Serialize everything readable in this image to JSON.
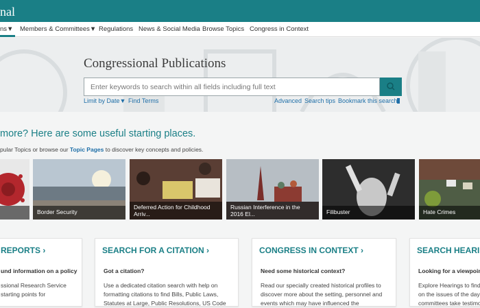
{
  "header": {
    "brand": "nal"
  },
  "nav": {
    "items": [
      {
        "label": "ns▼"
      },
      {
        "label": "Members & Committees▼"
      },
      {
        "label": "Regulations"
      },
      {
        "label": "News & Social Media"
      },
      {
        "label": "Browse Topics"
      },
      {
        "label": "Congress in Context"
      }
    ]
  },
  "hero": {
    "title": "Congressional Publications",
    "search_placeholder": "Enter keywords to search within all fields including full text",
    "limit_by_date": "Limit by Date▼",
    "find_terms": "Find Terms",
    "advanced": "Advanced",
    "search_tips": "Search tips",
    "bookmark": "Bookmark this search"
  },
  "starting": {
    "heading": "more? Here are some useful starting places.",
    "intro_pre": "pular Topics or browse our ",
    "intro_link": "Topic Pages",
    "intro_post": " to discover key concepts and policies."
  },
  "tiles": [
    {
      "label": ""
    },
    {
      "label": "Border Security"
    },
    {
      "label": "Deferred Action for Childhood Arriv..."
    },
    {
      "label": "Russian Interference in the 2016 El..."
    },
    {
      "label": "Filibuster"
    },
    {
      "label": "Hate Crimes"
    }
  ],
  "cards": [
    {
      "title": "REPORTS ›",
      "subtitle": "und information on a policy",
      "body": "ssional Research Service\nstarting points for"
    },
    {
      "title": "SEARCH FOR A CITATION ›",
      "subtitle": "Got a citation?",
      "body": "Use a dedicated citation search with help on\nformatting citations to find Bills, Public Laws,\nStatutes at Large, Public Resolutions, US Code"
    },
    {
      "title": "CONGRESS IN CONTEXT ›",
      "subtitle": "Need some historical context?",
      "body": "Read our specially created historical profiles to\ndiscover more about the setting, personnel and\nevents which may have influenced the"
    },
    {
      "title": "SEARCH HEARIN",
      "subtitle": "Looking for a viewpoint",
      "body": "Explore Hearings to find\non the issues of the day\ncommittees take testimony"
    }
  ],
  "colors": {
    "accent": "#1a7f86",
    "link": "#1f6fa8"
  }
}
